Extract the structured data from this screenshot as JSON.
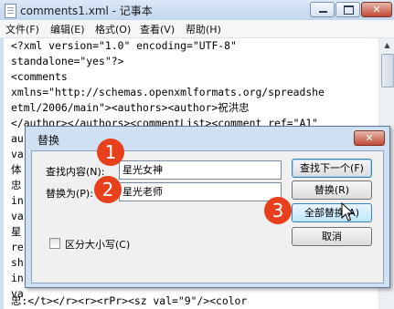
{
  "window": {
    "title": "comments1.xml - 记事本",
    "close_glyph": "✕"
  },
  "menu": [
    "文件(F)",
    "编辑(E)",
    "格式(O)",
    "查看(V)",
    "帮助(H)"
  ],
  "editor": {
    "lines": [
      "<?xml version=\"1.0\" encoding=\"UTF-8\"",
      "standalone=\"yes\"?>",
      "<comments",
      "xmlns=\"http://schemas.openxmlformats.org/spreadshe",
      "etml/2006/main\"><authors><author>祝洪忠",
      "</author></authors><commentList><comment ref=\"A1\"",
      "au",
      "va",
      "体",
      "忠",
      "in",
      "va",
      "星",
      "re",
      "sh",
      "in",
      "va",
      "忠:</t></r><r><rPr><sz val=\"9\"/><color"
    ]
  },
  "dialog": {
    "title": "替换",
    "close_glyph": "✕",
    "find_label": "查找内容(N):",
    "find_value": "星光女神",
    "replace_label": "替换为(P):",
    "replace_value": "星光老师",
    "match_case_label": "区分大小写(C)",
    "find_next_button": "查找下一个(F)",
    "replace_button": "替换(R)",
    "replace_all_button": "全部替换(A)",
    "cancel_button": "取消"
  },
  "annotations": [
    "1",
    "2",
    "3"
  ]
}
